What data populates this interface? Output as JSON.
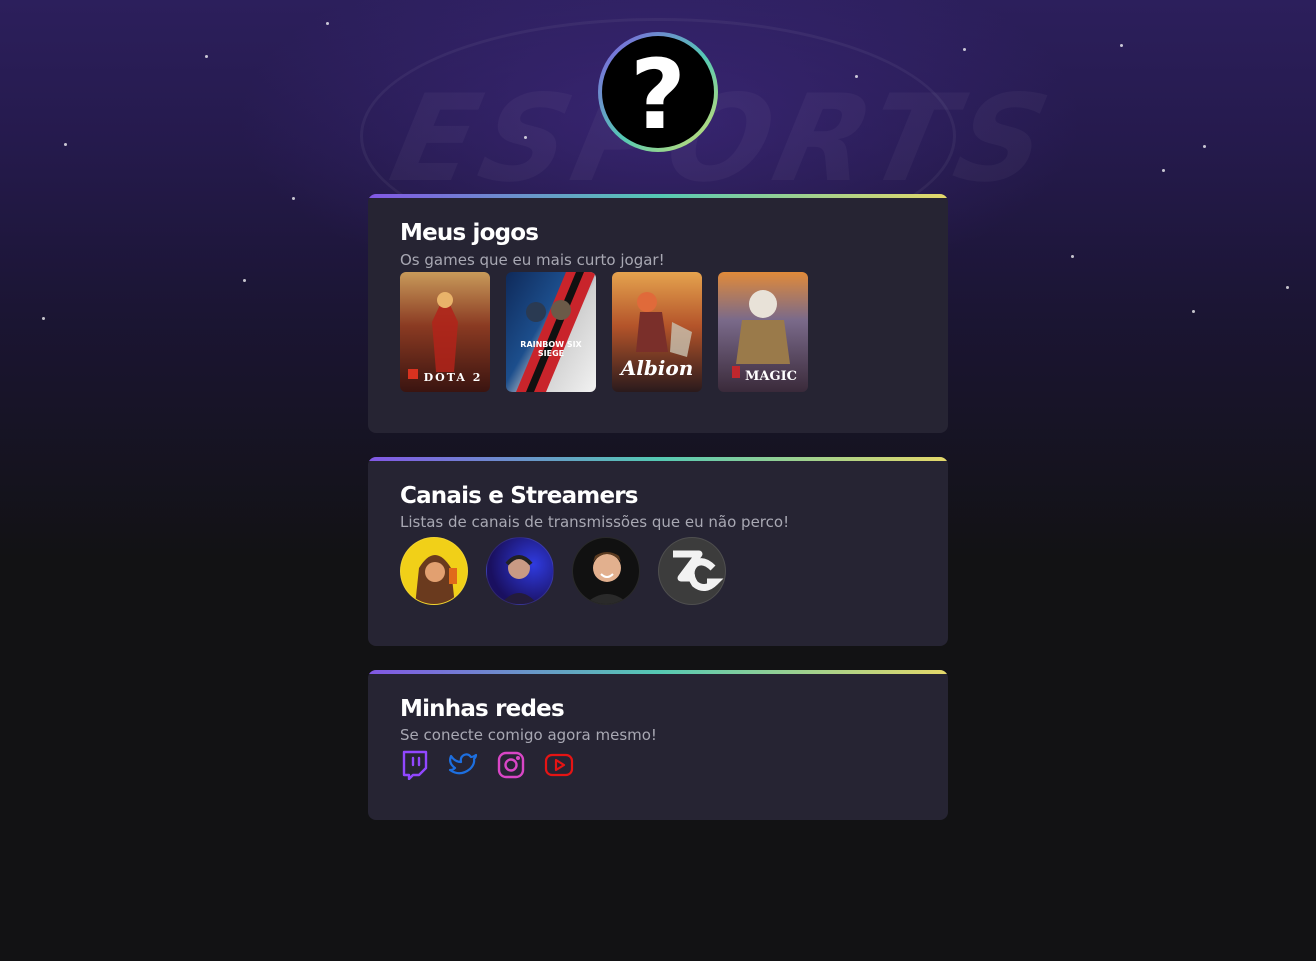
{
  "background": {
    "logo_text": "ESPORTS"
  },
  "profile": {
    "avatar_glyph": "?"
  },
  "games_section": {
    "title": "Meus jogos",
    "subtitle": "Os games que eu mais curto jogar!",
    "games": [
      {
        "name": "DOTA 2",
        "color": "#7a2a1c"
      },
      {
        "name": "RAINBOW SIX SIEGE",
        "color": "#c9242b"
      },
      {
        "name": "Albion",
        "color": "#a4562a"
      },
      {
        "name": "MAGIC",
        "color": "#6d5a7a"
      }
    ]
  },
  "streamers_section": {
    "title": "Canais e Streamers",
    "subtitle": "Listas de canais de transmissões que eu não perco!",
    "streamers": [
      {
        "icon": "hooded-character-avatar",
        "color": "#f1d018"
      },
      {
        "icon": "headset-streamer-avatar",
        "color": "#2a1fb8"
      },
      {
        "icon": "smiling-man-avatar",
        "color": "#1a1a1a"
      },
      {
        "icon": "zg-logo-avatar",
        "color": "#3c3c3c"
      }
    ]
  },
  "social_section": {
    "title": "Minhas redes",
    "subtitle": "Se conecte comigo agora mesmo!",
    "links": [
      {
        "icon": "twitch-icon",
        "color": "#9147ff"
      },
      {
        "icon": "twitter-icon",
        "color": "#1d6fe0"
      },
      {
        "icon": "instagram-icon",
        "color": "#d946c6"
      },
      {
        "icon": "youtube-icon",
        "color": "#e51414"
      }
    ]
  }
}
